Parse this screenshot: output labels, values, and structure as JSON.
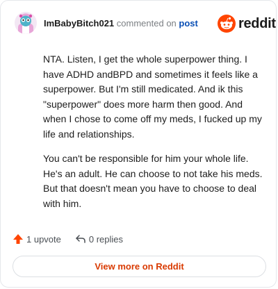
{
  "header": {
    "username": "ImBabyBitch021",
    "commented_text": "commented on",
    "post_link": "post",
    "brand": "reddit"
  },
  "comment": {
    "paragraphs": [
      "NTA. Listen, I get the whole superpower thing. I have ADHD andBPD and sometimes it feels like a superpower. But I'm still medicated. And ik this \"superpower\" does more harm then good. And when I chose to come off my meds, I fucked up my life and relationships.",
      "You can't be responsible for him your whole life. He's an adult. He can choose to not take his meds. But that doesn't mean you have to choose to deal with him."
    ]
  },
  "actions": {
    "upvote_label": "1 upvote",
    "replies_label": "0 replies"
  },
  "cta": {
    "label": "View more on Reddit"
  },
  "colors": {
    "brand_orange": "#ff4500",
    "upvote_arrow": "#ff4500",
    "cta_text": "#d93a00",
    "link_blue": "#0a4fb5"
  },
  "icons": {
    "avatar": "snoo-avatar-icon",
    "logo": "reddit-logo-icon",
    "upvote": "upvote-arrow-icon",
    "reply": "reply-arrow-icon"
  }
}
